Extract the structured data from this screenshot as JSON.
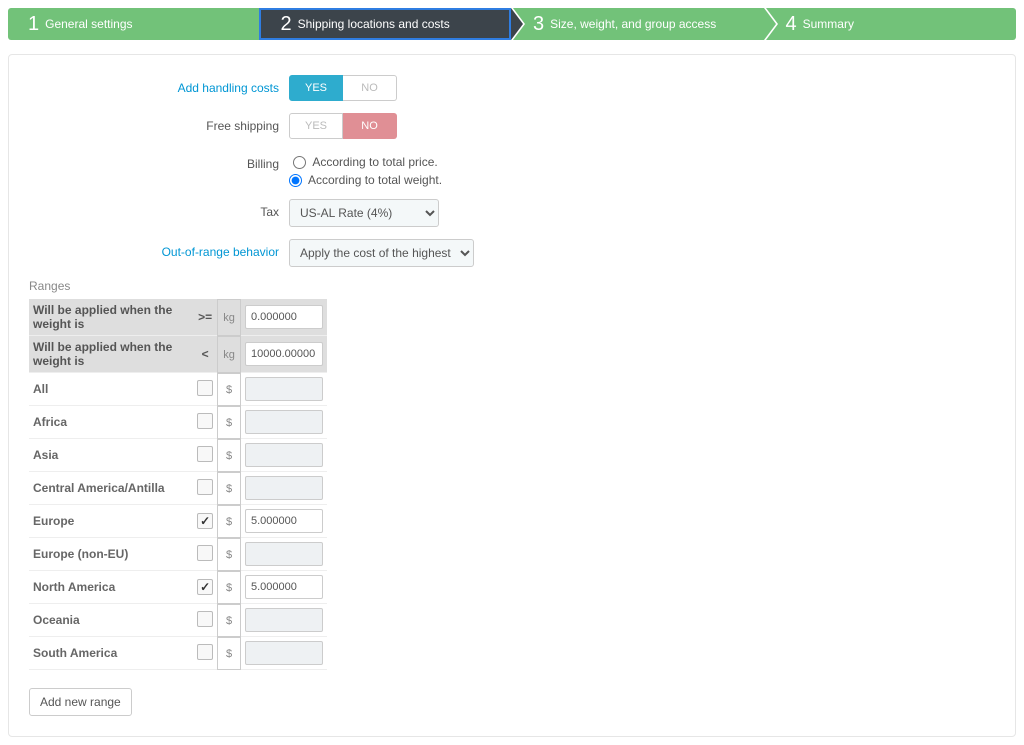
{
  "steps": [
    {
      "num": "1",
      "label": "General settings",
      "active": false
    },
    {
      "num": "2",
      "label": "Shipping locations and costs",
      "active": true
    },
    {
      "num": "3",
      "label": "Size, weight, and group access",
      "active": false
    },
    {
      "num": "4",
      "label": "Summary",
      "active": false
    }
  ],
  "form": {
    "handling": {
      "label": "Add handling costs",
      "yes": "YES",
      "no": "NO",
      "value": "yes"
    },
    "free": {
      "label": "Free shipping",
      "yes": "YES",
      "no": "NO",
      "value": "no"
    },
    "billing": {
      "label": "Billing",
      "options": [
        {
          "text": "According to total price.",
          "checked": false
        },
        {
          "text": "According to total weight.",
          "checked": true
        }
      ]
    },
    "tax": {
      "label": "Tax",
      "value": "US-AL Rate (4%)"
    },
    "range": {
      "label": "Out-of-range behavior",
      "value": "Apply the cost of the highest"
    }
  },
  "ranges": {
    "title": "Ranges",
    "unit_weight": "kg",
    "unit_price": "$",
    "header_rows": [
      {
        "label": "Will be applied when the weight is",
        "op": ">=",
        "value": "0.000000"
      },
      {
        "label": "Will be applied when the weight is",
        "op": "<",
        "value": "10000.00000"
      }
    ],
    "zones": [
      {
        "label": "All",
        "checked": false,
        "value": ""
      },
      {
        "label": "Africa",
        "checked": false,
        "value": ""
      },
      {
        "label": "Asia",
        "checked": false,
        "value": ""
      },
      {
        "label": "Central America/Antilla",
        "checked": false,
        "value": ""
      },
      {
        "label": "Europe",
        "checked": true,
        "value": "5.000000"
      },
      {
        "label": "Europe (non-EU)",
        "checked": false,
        "value": ""
      },
      {
        "label": "North America",
        "checked": true,
        "value": "5.000000"
      },
      {
        "label": "Oceania",
        "checked": false,
        "value": ""
      },
      {
        "label": "South America",
        "checked": false,
        "value": ""
      }
    ],
    "add_button": "Add new range"
  }
}
